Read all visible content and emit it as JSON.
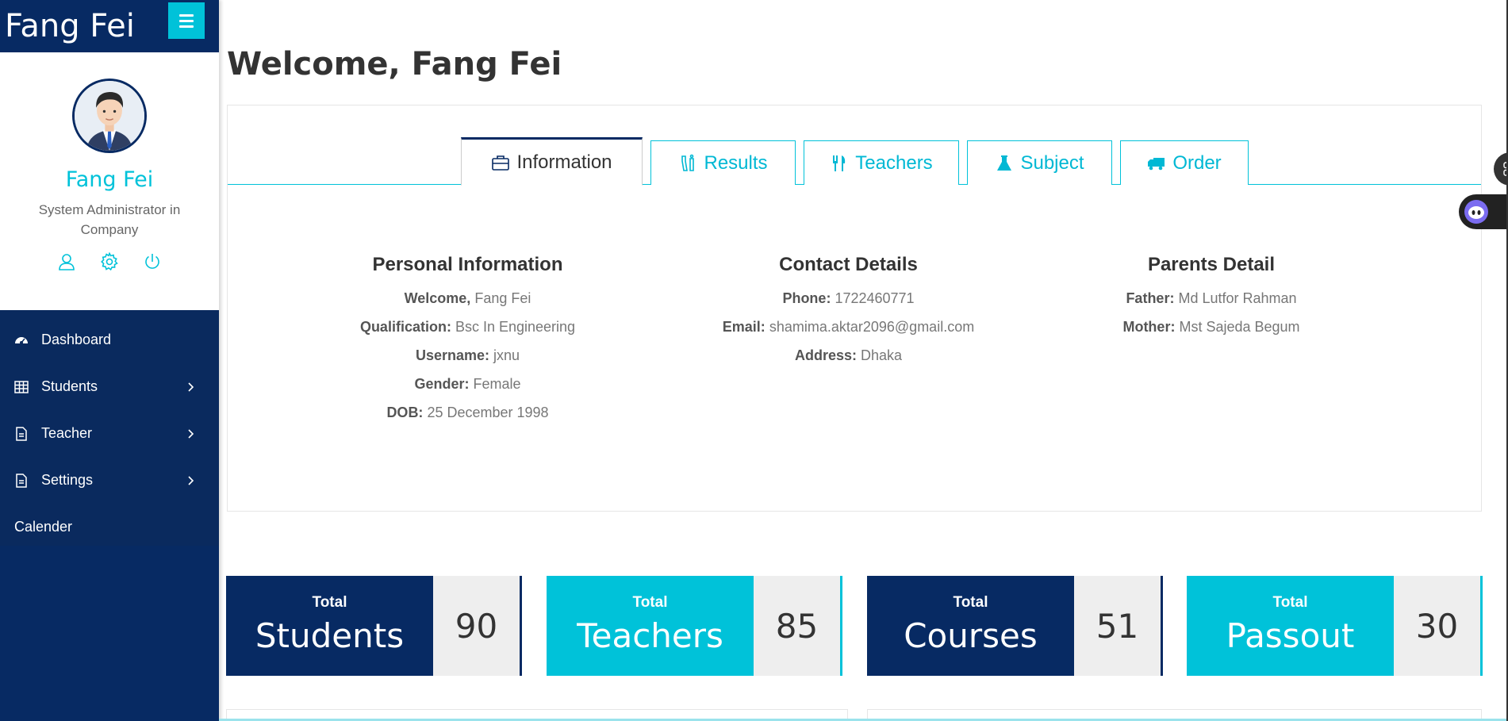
{
  "brand": "Fang Fei",
  "profile": {
    "name": "Fang Fei",
    "role": "System Administrator in Company"
  },
  "nav": {
    "dashboard": "Dashboard",
    "students": "Students",
    "teacher": "Teacher",
    "settings": "Settings",
    "calender": "Calender"
  },
  "page_title": "Welcome, Fang Fei",
  "tabs": {
    "information": "Information",
    "results": "Results",
    "teachers": "Teachers",
    "subject": "Subject",
    "order": "Order"
  },
  "personal": {
    "heading": "Personal Information",
    "welcome_label": "Welcome,",
    "welcome_value": "Fang Fei",
    "qualification_label": "Qualification:",
    "qualification_value": "Bsc In Engineering",
    "username_label": "Username:",
    "username_value": "jxnu",
    "gender_label": "Gender:",
    "gender_value": "Female",
    "dob_label": "DOB:",
    "dob_value": "25 December 1998"
  },
  "contact": {
    "heading": "Contact Details",
    "phone_label": "Phone:",
    "phone_value": "1722460771",
    "email_label": "Email:",
    "email_value": "shamima.aktar2096@gmail.com",
    "address_label": "Address:",
    "address_value": "Dhaka"
  },
  "parents": {
    "heading": "Parents Detail",
    "father_label": "Father:",
    "father_value": "Md Lutfor Rahman",
    "mother_label": "Mother:",
    "mother_value": "Mst Sajeda Begum"
  },
  "stats": [
    {
      "small": "Total",
      "big": "Students",
      "value": "90"
    },
    {
      "small": "Total",
      "big": "Teachers",
      "value": "85"
    },
    {
      "small": "Total",
      "big": "Courses",
      "value": "51"
    },
    {
      "small": "Total",
      "big": "Passout",
      "value": "30"
    }
  ],
  "colors": {
    "navy": "#072a63",
    "cyan": "#00c2d9"
  }
}
